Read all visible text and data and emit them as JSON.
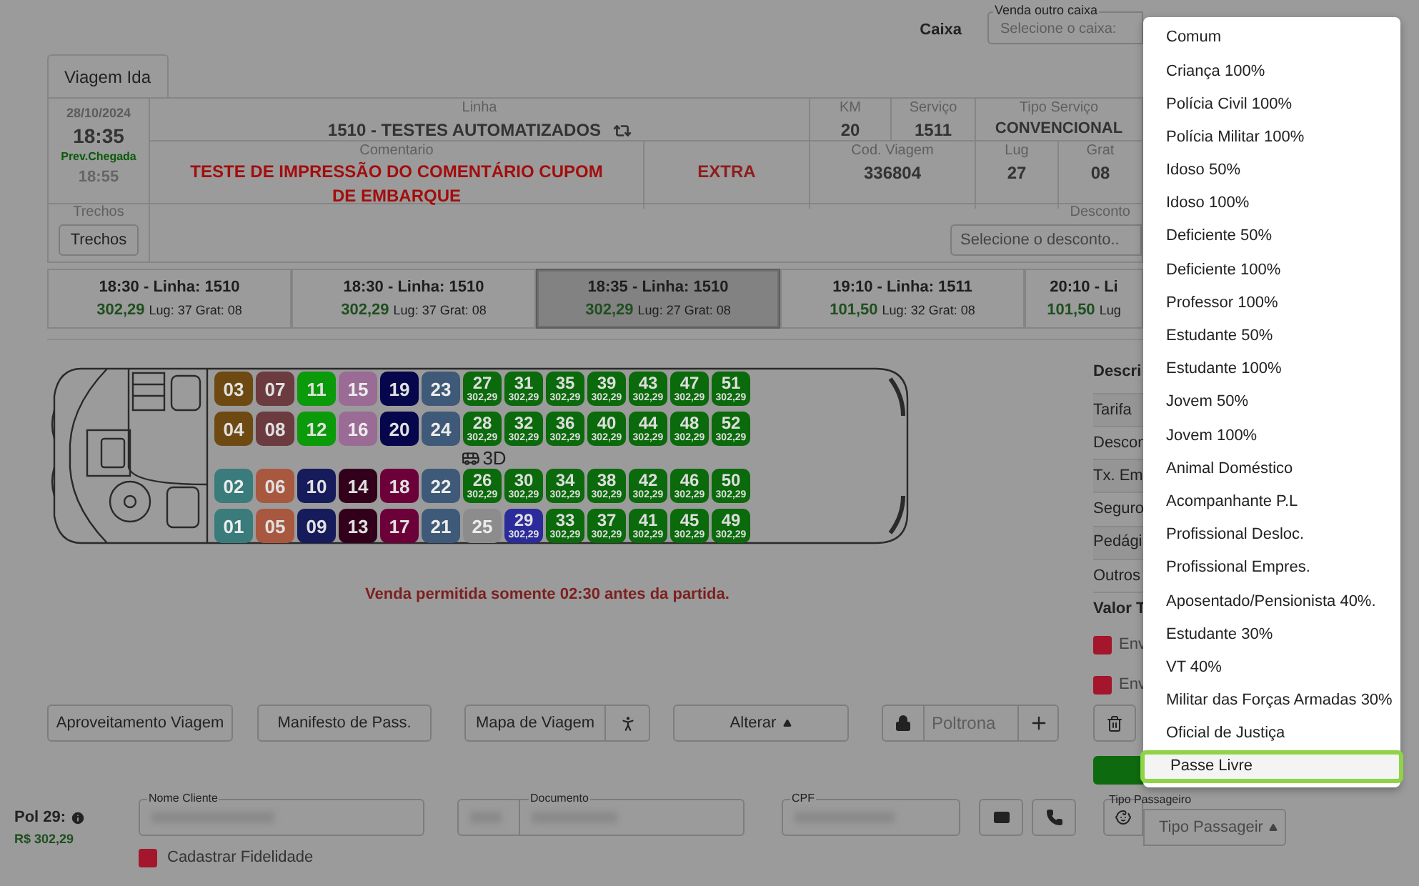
{
  "header": {
    "caixa_label": "Caixa",
    "other_box": {
      "legend": "Venda outro caixa",
      "placeholder": "Selecione o caixa:"
    }
  },
  "tabs": [
    {
      "label": "Viagem Ida",
      "selected": true
    }
  ],
  "trip": {
    "date": "28/10/2024",
    "departure": "18:35",
    "arrival_label": "Prev.Chegada",
    "arrival": "18:55",
    "linha": {
      "label": "Linha",
      "value": "1510 - TESTES AUTOMATIZADOS"
    },
    "km": {
      "label": "KM",
      "value": "20"
    },
    "servico": {
      "label": "Serviço",
      "value": "1511"
    },
    "tipo_servico": {
      "label": "Tipo Serviço",
      "value": "CONVENCIONAL"
    },
    "comentario": {
      "label": "Comentario",
      "value": "TESTE DE IMPRESSÃO DO COMENTÁRIO CUPOM DE EMBARQUE"
    },
    "extra": "EXTRA",
    "cod_viagem": {
      "label": "Cod. Viagem",
      "value": "336804"
    },
    "lug": {
      "label": "Lug",
      "value": "27"
    },
    "grat": {
      "label": "Grat",
      "value": "08"
    },
    "trechos": {
      "label": "Trechos",
      "button": "Trechos"
    },
    "desconto": {
      "label": "Desconto",
      "placeholder": "Selecione o desconto.."
    }
  },
  "schedules": [
    {
      "title": "18:30 - Linha: 1510",
      "price": "302,29",
      "info": "Lug: 37 Grat: 08",
      "selected": false
    },
    {
      "title": "18:30 - Linha: 1510",
      "price": "302,29",
      "info": "Lug: 37 Grat: 08",
      "selected": false
    },
    {
      "title": "18:35 - Linha: 1510",
      "price": "302,29",
      "info": "Lug: 27 Grat: 08",
      "selected": true
    },
    {
      "title": "19:10 - Linha: 1511",
      "price": "101,50",
      "info": "Lug: 32 Grat: 08",
      "selected": false
    },
    {
      "title": "20:10 - Li",
      "price": "101,50",
      "info": "Lug",
      "selected": false
    }
  ],
  "seat_map": {
    "aisle_label": "3D",
    "rows": [
      [
        {
          "number": "03",
          "color": "#6e4a12",
          "kind": "sold"
        },
        {
          "number": "07",
          "color": "#6b3b40",
          "kind": "sold"
        },
        {
          "number": "11",
          "color": "#0a9a0a",
          "kind": "sold"
        },
        {
          "number": "15",
          "color": "#9a6b95",
          "kind": "blocked"
        },
        {
          "number": "19",
          "color": "#06064c",
          "kind": "sold"
        },
        {
          "number": "23",
          "color": "#3f5a78",
          "kind": "blocked"
        },
        {
          "number": "27",
          "color": "#0b6a0b",
          "kind": "free",
          "price": "302,29"
        },
        {
          "number": "31",
          "color": "#0b6a0b",
          "kind": "free",
          "price": "302,29"
        },
        {
          "number": "35",
          "color": "#0b6a0b",
          "kind": "free",
          "price": "302,29"
        },
        {
          "number": "39",
          "color": "#0b6a0b",
          "kind": "free",
          "price": "302,29"
        },
        {
          "number": "43",
          "color": "#0b6a0b",
          "kind": "free",
          "price": "302,29"
        },
        {
          "number": "47",
          "color": "#0b6a0b",
          "kind": "free",
          "price": "302,29"
        },
        {
          "number": "51",
          "color": "#0b6a0b",
          "kind": "free",
          "price": "302,29"
        }
      ],
      [
        {
          "number": "04",
          "color": "#6e4a12",
          "kind": "sold"
        },
        {
          "number": "08",
          "color": "#6b3b40",
          "kind": "sold"
        },
        {
          "number": "12",
          "color": "#0a9a0a",
          "kind": "sold"
        },
        {
          "number": "16",
          "color": "#9a6b95",
          "kind": "blocked"
        },
        {
          "number": "20",
          "color": "#06064c",
          "kind": "sold"
        },
        {
          "number": "24",
          "color": "#3f5a78",
          "kind": "blocked"
        },
        {
          "number": "28",
          "color": "#0b6a0b",
          "kind": "free",
          "price": "302,29"
        },
        {
          "number": "32",
          "color": "#0b6a0b",
          "kind": "free",
          "price": "302,29"
        },
        {
          "number": "36",
          "color": "#0b6a0b",
          "kind": "free",
          "price": "302,29"
        },
        {
          "number": "40",
          "color": "#0b6a0b",
          "kind": "free",
          "price": "302,29"
        },
        {
          "number": "44",
          "color": "#0b6a0b",
          "kind": "free",
          "price": "302,29"
        },
        {
          "number": "48",
          "color": "#0b6a0b",
          "kind": "free",
          "price": "302,29"
        },
        {
          "number": "52",
          "color": "#0b6a0b",
          "kind": "free",
          "price": "302,29"
        }
      ],
      [
        {
          "number": "02",
          "color": "#3a7b7b",
          "kind": "blocked"
        },
        {
          "number": "06",
          "color": "#a8583f",
          "kind": "sold"
        },
        {
          "number": "10",
          "color": "#161b5b",
          "kind": "sold"
        },
        {
          "number": "14",
          "color": "#33001b",
          "kind": "sold"
        },
        {
          "number": "18",
          "color": "#6c0039",
          "kind": "sold"
        },
        {
          "number": "22",
          "color": "#3f5a78",
          "kind": "blocked"
        },
        {
          "number": "26",
          "color": "#0b6a0b",
          "kind": "free",
          "price": "302,29"
        },
        {
          "number": "30",
          "color": "#0b6a0b",
          "kind": "free",
          "price": "302,29"
        },
        {
          "number": "34",
          "color": "#0b6a0b",
          "kind": "free",
          "price": "302,29"
        },
        {
          "number": "38",
          "color": "#0b6a0b",
          "kind": "free",
          "price": "302,29"
        },
        {
          "number": "42",
          "color": "#0b6a0b",
          "kind": "free",
          "price": "302,29"
        },
        {
          "number": "46",
          "color": "#0b6a0b",
          "kind": "free",
          "price": "302,29"
        },
        {
          "number": "50",
          "color": "#0b6a0b",
          "kind": "free",
          "price": "302,29"
        }
      ],
      [
        {
          "number": "01",
          "color": "#3a7b7b",
          "kind": "blocked"
        },
        {
          "number": "05",
          "color": "#a8583f",
          "kind": "sold"
        },
        {
          "number": "09",
          "color": "#161b5b",
          "kind": "sold"
        },
        {
          "number": "13",
          "color": "#33001b",
          "kind": "sold"
        },
        {
          "number": "17",
          "color": "#6c0039",
          "kind": "sold"
        },
        {
          "number": "21",
          "color": "#3f5a78",
          "kind": "blocked"
        },
        {
          "number": "25",
          "color": "#8c8c8c",
          "kind": "blocked"
        },
        {
          "number": "29",
          "color": "#2b2b9c",
          "kind": "chosen",
          "price": "302,29"
        },
        {
          "number": "33",
          "color": "#0b6a0b",
          "kind": "free",
          "price": "302,29"
        },
        {
          "number": "37",
          "color": "#0b6a0b",
          "kind": "free",
          "price": "302,29"
        },
        {
          "number": "41",
          "color": "#0b6a0b",
          "kind": "free",
          "price": "302,29"
        },
        {
          "number": "45",
          "color": "#0b6a0b",
          "kind": "free",
          "price": "302,29"
        },
        {
          "number": "49",
          "color": "#0b6a0b",
          "kind": "free",
          "price": "302,29"
        }
      ]
    ],
    "warning": "Venda permitida somente 02:30 antes da partida."
  },
  "price_table": {
    "header": "Descri",
    "rows": [
      "Tarifa",
      "Descon",
      "Tx. Em",
      "Seguro",
      "Pedági",
      "Outros"
    ],
    "total": "Valor T",
    "options": [
      {
        "label": "Env",
        "checked": true
      },
      {
        "label": "Env",
        "checked": true
      }
    ]
  },
  "actions": {
    "aproveitamento": "Aproveitamento Viagem",
    "manifesto": "Manifesto de Pass.",
    "mapa": "Mapa de Viagem",
    "alterar": "Alterar",
    "poltrona_placeholder": "Poltrona"
  },
  "passenger": {
    "seat": "Pol 29:",
    "price": "R$ 302,29",
    "nome_label": "Nome Cliente",
    "documento_label": "Documento",
    "cpf_label": "CPF",
    "tipo_label": "Tipo Passageiro",
    "tipo_value": "Tipo Passageir",
    "fidelidade": {
      "label": "Cadastrar Fidelidade",
      "checked": true
    }
  },
  "passenger_types": [
    {
      "label": "Comum",
      "selected": false
    },
    {
      "label": "Criança 100%",
      "selected": false
    },
    {
      "label": "Polícia Civil 100%",
      "selected": false
    },
    {
      "label": "Polícia Militar 100%",
      "selected": false
    },
    {
      "label": "Idoso 50%",
      "selected": false
    },
    {
      "label": "Idoso 100%",
      "selected": false
    },
    {
      "label": "Deficiente 50%",
      "selected": false
    },
    {
      "label": "Deficiente 100%",
      "selected": false
    },
    {
      "label": "Professor 100%",
      "selected": false
    },
    {
      "label": "Estudante 50%",
      "selected": false
    },
    {
      "label": "Estudante 100%",
      "selected": false
    },
    {
      "label": "Jovem 50%",
      "selected": false
    },
    {
      "label": "Jovem 100%",
      "selected": false
    },
    {
      "label": "Animal Doméstico",
      "selected": false
    },
    {
      "label": "Acompanhante P.L",
      "selected": false
    },
    {
      "label": "Profissional Desloc.",
      "selected": false
    },
    {
      "label": "Profissional Empres.",
      "selected": false
    },
    {
      "label": "Aposentado/Pensionista 40%.",
      "selected": false
    },
    {
      "label": "Estudante 30%",
      "selected": false
    },
    {
      "label": "VT 40%",
      "selected": false
    },
    {
      "label": "Militar das Forças Armadas 30%",
      "selected": false
    },
    {
      "label": "Oficial de Justiça",
      "selected": false
    },
    {
      "label": "Passe Livre",
      "selected": true
    }
  ]
}
